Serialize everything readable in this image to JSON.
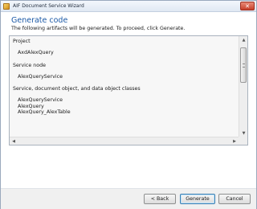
{
  "window": {
    "title": "AIF Document Service Wizard",
    "close_glyph": "✕"
  },
  "header": {
    "title": "Generate code",
    "subtitle": "The following artifacts will be generated. To proceed, click Generate."
  },
  "artifacts": {
    "sections": [
      {
        "heading": "Project",
        "items": [
          "AxdAlexQuery"
        ]
      },
      {
        "heading": "Service node",
        "items": [
          "AlexQueryService"
        ]
      },
      {
        "heading": "Service, document object, and data object classes",
        "items": [
          "AlexQueryService",
          "AlexQuery",
          "AlexQuery_AlexTable"
        ]
      }
    ]
  },
  "scrollbar": {
    "up_glyph": "▲",
    "down_glyph": "▼",
    "left_glyph": "◀",
    "right_glyph": "▶"
  },
  "buttons": {
    "back": "< Back",
    "generate": "Generate",
    "cancel": "Cancel"
  },
  "colors": {
    "title_blue": "#1c59a6",
    "default_button_border": "#3c7fb1"
  }
}
